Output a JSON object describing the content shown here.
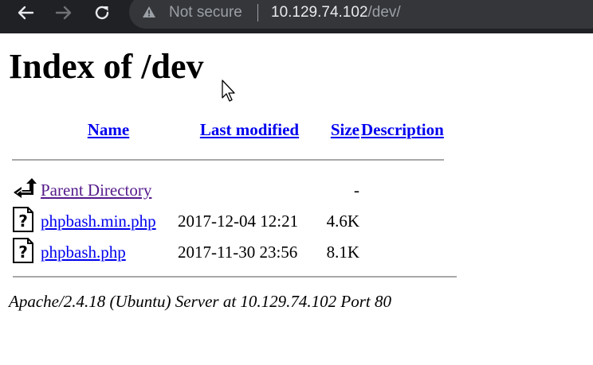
{
  "browser": {
    "security_label": "Not secure",
    "url_host": "10.129.74.102",
    "url_path": "/dev/"
  },
  "page": {
    "title": "Index of /dev",
    "columns": {
      "name": "Name",
      "last_modified": "Last modified",
      "size": "Size",
      "description": "Description"
    },
    "rows": [
      {
        "icon": "parent-directory-icon",
        "name": "Parent Directory",
        "modified": "",
        "size": "-",
        "description": ""
      },
      {
        "icon": "unknown-file-icon",
        "name": "phpbash.min.php",
        "modified": "2017-12-04 12:21",
        "size": "4.6K",
        "description": ""
      },
      {
        "icon": "unknown-file-icon",
        "name": "phpbash.php",
        "modified": "2017-11-30 23:56",
        "size": "8.1K",
        "description": ""
      }
    ],
    "server_signature": "Apache/2.4.18 (Ubuntu) Server at 10.129.74.102 Port 80"
  },
  "colors": {
    "link": "#0000ee",
    "visited": "#551a8b",
    "chrome_bg": "#202124"
  }
}
